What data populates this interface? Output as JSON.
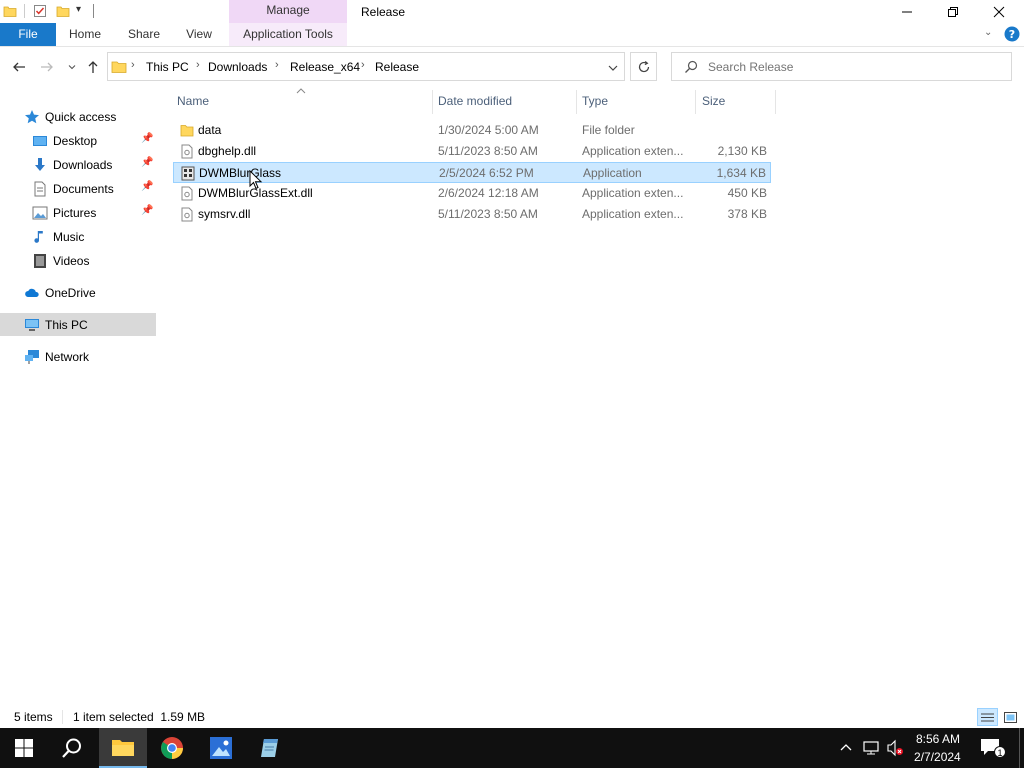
{
  "titlebar": {
    "context_tab": "Manage",
    "window_title": "Release"
  },
  "ribbon": {
    "tabs": [
      {
        "label": "File"
      },
      {
        "label": "Home"
      },
      {
        "label": "Share"
      },
      {
        "label": "View"
      },
      {
        "label": "Application Tools"
      }
    ]
  },
  "address": {
    "breadcrumbs": [
      "This PC",
      "Downloads",
      "Release_x64",
      "Release"
    ]
  },
  "search": {
    "placeholder": "Search Release"
  },
  "navpane": {
    "items": [
      {
        "label": "Quick access",
        "icon": "star-icon"
      },
      {
        "label": "Desktop",
        "icon": "desktop-icon",
        "pinned": true
      },
      {
        "label": "Downloads",
        "icon": "downloads-icon",
        "pinned": true
      },
      {
        "label": "Documents",
        "icon": "documents-icon",
        "pinned": true
      },
      {
        "label": "Pictures",
        "icon": "pictures-icon",
        "pinned": true
      },
      {
        "label": "Music",
        "icon": "music-icon"
      },
      {
        "label": "Videos",
        "icon": "videos-icon"
      },
      {
        "label": "OneDrive",
        "icon": "cloud-icon"
      },
      {
        "label": "This PC",
        "icon": "computer-icon",
        "selected": true
      },
      {
        "label": "Network",
        "icon": "network-icon"
      }
    ]
  },
  "filelist": {
    "columns": {
      "name": "Name",
      "date": "Date modified",
      "type": "Type",
      "size": "Size"
    },
    "rows": [
      {
        "name": "data",
        "date": "1/30/2024 5:00 AM",
        "type": "File folder",
        "size": "",
        "icon": "folder-icon"
      },
      {
        "name": "dbghelp.dll",
        "date": "5/11/2023 8:50 AM",
        "type": "Application exten...",
        "size": "2,130 KB",
        "icon": "dll-file-icon"
      },
      {
        "name": "DWMBlurGlass",
        "date": "2/5/2024 6:52 PM",
        "type": "Application",
        "size": "1,634 KB",
        "icon": "application-icon",
        "selected": true
      },
      {
        "name": "DWMBlurGlassExt.dll",
        "date": "2/6/2024 12:18 AM",
        "type": "Application exten...",
        "size": "450 KB",
        "icon": "dll-file-icon"
      },
      {
        "name": "symsrv.dll",
        "date": "5/11/2023 8:50 AM",
        "type": "Application exten...",
        "size": "378 KB",
        "icon": "dll-file-icon"
      }
    ]
  },
  "statusbar": {
    "item_count": "5 items",
    "selection": "1 item selected  1.59 MB"
  },
  "taskbar": {
    "time": "8:56 AM",
    "date": "2/7/2024",
    "notification_count": "1"
  },
  "colors": {
    "file_tab": "#1979ca",
    "manage_tab": "#f0d8f6",
    "selection": "#cce8ff",
    "taskbar": "#101010"
  }
}
